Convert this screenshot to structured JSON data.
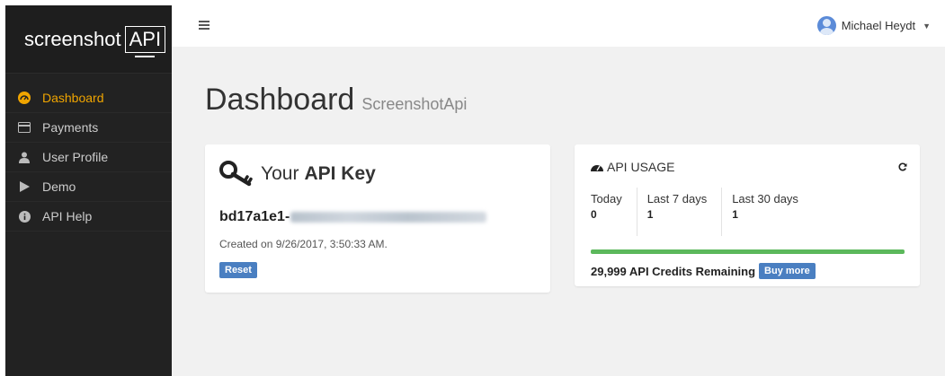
{
  "brand": {
    "text": "screenshot",
    "boxed": "API"
  },
  "sidebar": {
    "items": [
      {
        "label": "Dashboard",
        "icon": "dashboard-icon",
        "active": true
      },
      {
        "label": "Payments",
        "icon": "credit-card-icon",
        "active": false
      },
      {
        "label": "User Profile",
        "icon": "user-icon",
        "active": false
      },
      {
        "label": "Demo",
        "icon": "play-icon",
        "active": false
      },
      {
        "label": "API Help",
        "icon": "info-icon",
        "active": false
      }
    ]
  },
  "topbar": {
    "user_name": "Michael Heydt"
  },
  "page": {
    "title": "Dashboard",
    "subtitle": "ScreenshotApi"
  },
  "api_key_card": {
    "heading_prefix": "Your",
    "heading_bold": "API Key",
    "key_visible": "bd17a1e1-",
    "created": "Created on 9/26/2017, 3:50:33 AM.",
    "reset_label": "Reset"
  },
  "usage_card": {
    "title": "API USAGE",
    "stats": [
      {
        "label": "Today",
        "value": "0"
      },
      {
        "label": "Last 7 days",
        "value": "1"
      },
      {
        "label": "Last 30 days",
        "value": "1"
      }
    ],
    "progress_fraction": 1.0,
    "credits_text": "29,999 API Credits Remaining",
    "buy_label": "Buy more"
  },
  "colors": {
    "accent": "#f0a500",
    "sidebar_bg": "#222222",
    "button": "#4a7fc1",
    "progress": "#5cb85c"
  }
}
